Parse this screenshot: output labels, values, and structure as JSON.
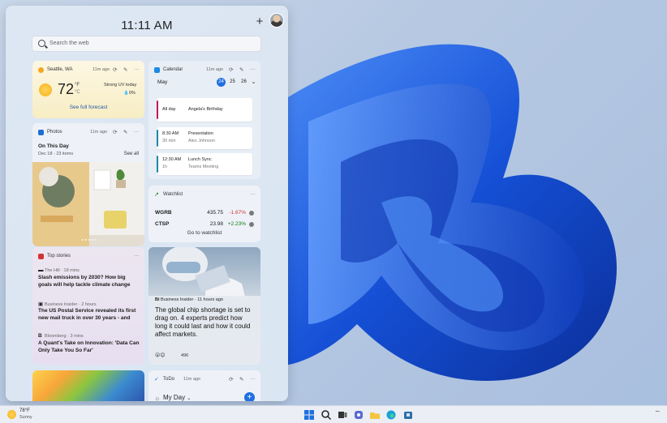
{
  "clock": "11:11 AM",
  "search": {
    "placeholder": "Search the web"
  },
  "weather": {
    "location": "Seattle, WA",
    "age": "11m ago",
    "temp": "72",
    "unit": "°F",
    "unit_alt": "°C",
    "uv": "Strong UV today",
    "precip": "0%",
    "forecast_link": "See full forecast"
  },
  "calendar": {
    "title": "Calendar",
    "age": "11m ago",
    "month": "May",
    "days": [
      "24",
      "25",
      "26"
    ],
    "events": [
      {
        "time": "All day",
        "sub": "",
        "name": "Angela's Birthday",
        "detail": "",
        "color": "#c2185b"
      },
      {
        "time": "8:30 AM",
        "sub": "30 min",
        "name": "Presentation",
        "detail": "Alex Johnson",
        "color": "#1e88a8"
      },
      {
        "time": "12:30 AM",
        "sub": "1h",
        "name": "Lunch Sync",
        "detail": "Teams Meeting",
        "color": "#1e88a8"
      }
    ]
  },
  "photos": {
    "title": "Photos",
    "age": "11m ago",
    "heading": "On This Day",
    "range": "Dec 18 - 23 items",
    "see_all": "See all"
  },
  "watchlist": {
    "title": "Watchlist",
    "stocks": [
      {
        "symbol": "WGRB",
        "price": "435.75",
        "change": "-1.67%",
        "color": "#d13438"
      },
      {
        "symbol": "CTSP",
        "price": "23.98",
        "change": "+2.23%",
        "color": "#107c10"
      }
    ],
    "link": "Go to watchlist"
  },
  "stories": {
    "title": "Top stories",
    "items": [
      {
        "source": "The Hill · 18 mins",
        "headline": "Slash emissions by 2030? How big goals will help tackle climate change"
      },
      {
        "source": "Business Insider · 2 hours",
        "headline": "The US Postal Service revealed its first new mail truck in over 30 years - and"
      },
      {
        "source": "Bloomberg · 3 mins",
        "headline": "A Quant's Take on Innovation: 'Data Can Only Take You So Far'"
      }
    ]
  },
  "chip": {
    "source": "Business Insider · 11 hours ago",
    "headline": "The global chip shortage is set to drag on. 4 experts predict how long it could last and how it could affect markets.",
    "reactions": "496"
  },
  "todo": {
    "title": "ToDo",
    "age": "11m ago",
    "list": "My Day"
  },
  "taskbar": {
    "temp": "78°F",
    "condition": "Sunny"
  },
  "colors": {
    "accent": "#1f6fe0",
    "bloom": "#1a5ae0"
  }
}
